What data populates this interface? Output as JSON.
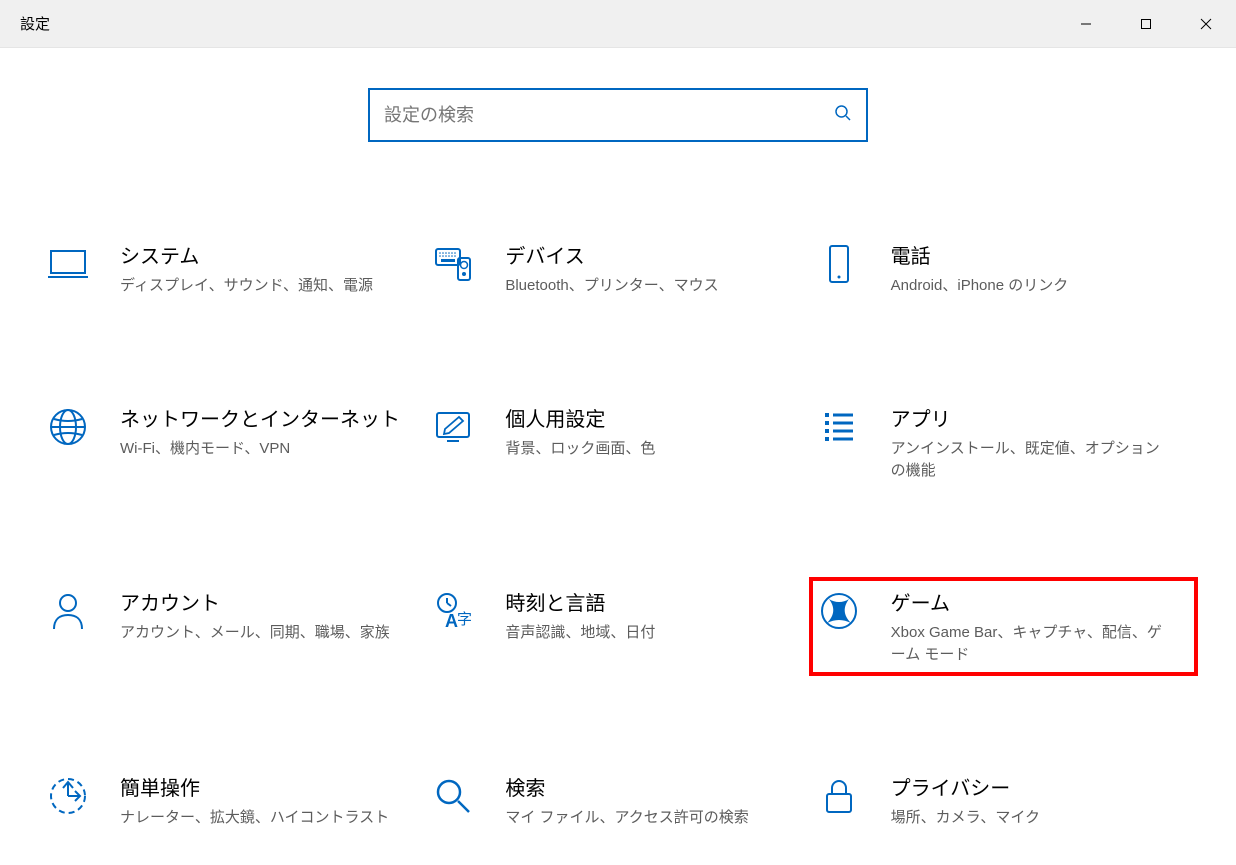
{
  "window": {
    "title": "設定"
  },
  "search": {
    "placeholder": "設定の検索"
  },
  "categories": [
    {
      "id": "system",
      "title": "システム",
      "desc": "ディスプレイ、サウンド、通知、電源"
    },
    {
      "id": "devices",
      "title": "デバイス",
      "desc": "Bluetooth、プリンター、マウス"
    },
    {
      "id": "phone",
      "title": "電話",
      "desc": "Android、iPhone のリンク"
    },
    {
      "id": "network",
      "title": "ネットワークとインターネット",
      "desc": "Wi-Fi、機内モード、VPN"
    },
    {
      "id": "personalization",
      "title": "個人用設定",
      "desc": "背景、ロック画面、色"
    },
    {
      "id": "apps",
      "title": "アプリ",
      "desc": "アンインストール、既定値、オプションの機能"
    },
    {
      "id": "accounts",
      "title": "アカウント",
      "desc": "アカウント、メール、同期、職場、家族"
    },
    {
      "id": "time",
      "title": "時刻と言語",
      "desc": "音声認識、地域、日付"
    },
    {
      "id": "gaming",
      "title": "ゲーム",
      "desc": "Xbox Game Bar、キャプチャ、配信、ゲーム モード",
      "highlight": true
    },
    {
      "id": "ease",
      "title": "簡単操作",
      "desc": "ナレーター、拡大鏡、ハイコントラスト"
    },
    {
      "id": "search",
      "title": "検索",
      "desc": "マイ ファイル、アクセス許可の検索"
    },
    {
      "id": "privacy",
      "title": "プライバシー",
      "desc": "場所、カメラ、マイク"
    }
  ]
}
